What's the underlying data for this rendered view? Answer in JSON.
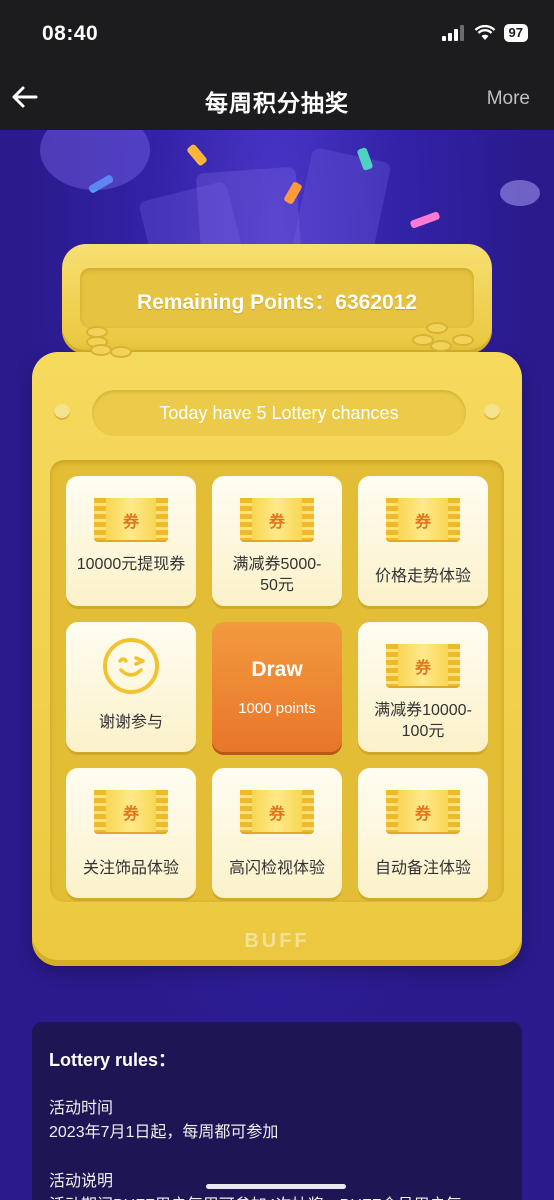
{
  "status_bar": {
    "time": "08:40",
    "battery": "97"
  },
  "nav": {
    "title": "每周积分抽奖",
    "more_label": "More"
  },
  "header": {
    "points_label": "Remaining Points：",
    "points_value": "6362012",
    "chances_text": "Today have 5 Lottery chances"
  },
  "coupon_char": "券",
  "prizes": [
    {
      "label": "10000元提现券",
      "icon": "coupon-icon"
    },
    {
      "label": "满减券5000-50元",
      "icon": "coupon-icon"
    },
    {
      "label": "价格走势体验",
      "icon": "coupon-icon"
    },
    {
      "label": "谢谢参与",
      "icon": "smiley-icon"
    },
    {
      "label": "满减券10000-100元",
      "icon": "coupon-icon"
    },
    {
      "label": "关注饰品体验",
      "icon": "coupon-icon"
    },
    {
      "label": "高闪检视体验",
      "icon": "coupon-icon"
    },
    {
      "label": "自动备注体验",
      "icon": "coupon-icon"
    }
  ],
  "draw_button": {
    "title": "Draw",
    "cost": "1000 points"
  },
  "brand": "BUFF",
  "rules": {
    "title": "Lottery rules：",
    "time_heading": "活动时间",
    "time_text": "2023年7月1日起，每周都可参加",
    "desc_heading": "活动说明",
    "desc_text": "活动期间BUFF用户每周可参加4次抽奖，BUFF会员用户每"
  },
  "colors": {
    "background": "#2a1a8c",
    "box_gold": "#f6da5e",
    "draw_orange": "#e8762a",
    "ticket_text": "#e0761c"
  }
}
